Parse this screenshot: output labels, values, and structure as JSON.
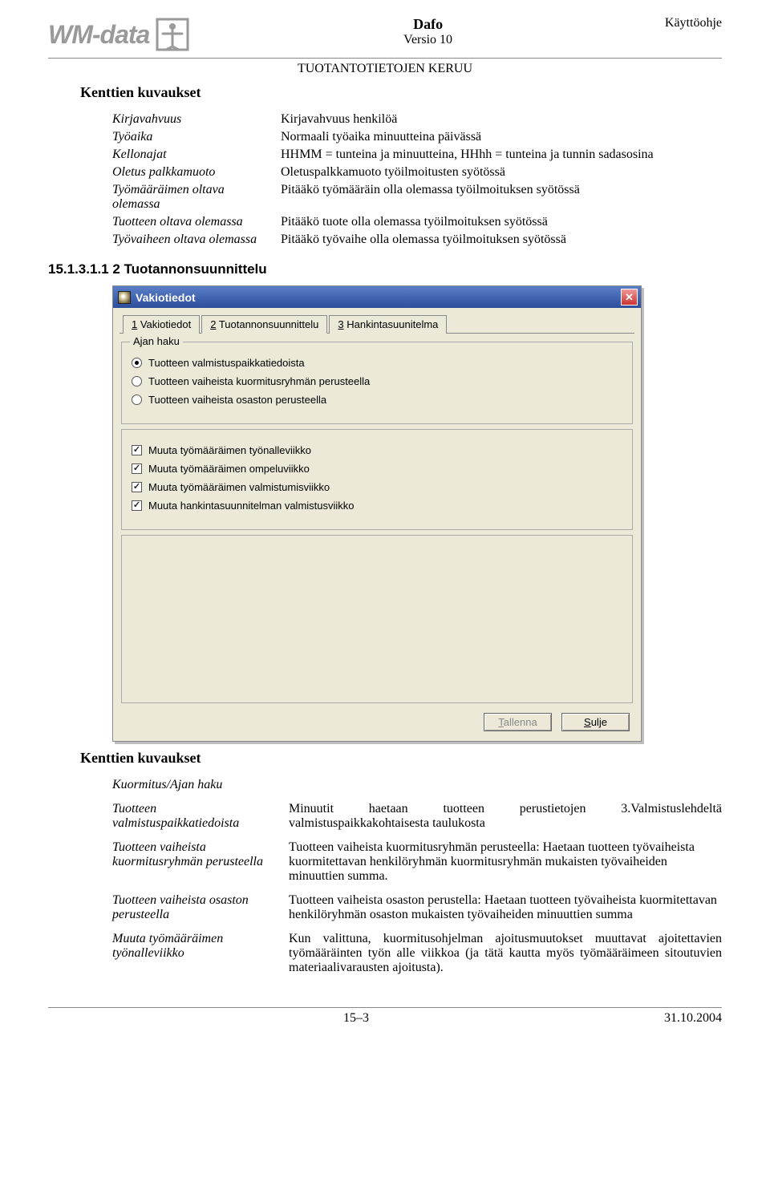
{
  "header": {
    "logo_text": "WM-data",
    "doc_title": "Dafo",
    "doc_version": "Versio 10",
    "doc_type": "Käyttöohje",
    "sub_title": "TUOTANTOTIETOJEN KERUU"
  },
  "section1_heading": "Kenttien kuvaukset",
  "defs1": [
    {
      "term": "Kirjavahvuus",
      "desc": "Kirjavahvuus henkilöä"
    },
    {
      "term": "Työaika",
      "desc": "Normaali työaika minuutteina päivässä"
    },
    {
      "term": "Kellonajat",
      "desc": "HHMM = tunteina ja minuutteina, HHhh = tunteina ja tunnin sadasosina"
    },
    {
      "term": "Oletus palkkamuoto",
      "desc": "Oletuspalkkamuoto työilmoitusten syötössä"
    },
    {
      "term": "Työmääräimen oltava olemassa",
      "desc": "Pitääkö työmääräin olla olemassa työilmoituksen syötössä"
    },
    {
      "term": "Tuotteen oltava olemassa",
      "desc": "Pitääkö tuote olla olemassa työilmoituksen syötössä"
    },
    {
      "term": "Työvaiheen oltava olemassa",
      "desc": "Pitääkö työvaihe olla olemassa työilmoituksen syötössä"
    }
  ],
  "sub_section_label": "15.1.3.1.1 2 Tuotannonsuunnittelu",
  "window": {
    "title": "Vakiotiedot",
    "tabs": [
      {
        "mnemonic": "1",
        "label": " Vakiotiedot"
      },
      {
        "mnemonic": "2",
        "label": " Tuotannonsuunnittelu",
        "active": true
      },
      {
        "mnemonic": "3",
        "label": " Hankintasuunitelma"
      }
    ],
    "group_title": "Ajan haku",
    "radios": [
      {
        "label": "Tuotteen valmistuspaikkatiedoista",
        "checked": true
      },
      {
        "label": "Tuotteen vaiheista kuormitusryhmän perusteella",
        "checked": false
      },
      {
        "label": "Tuotteen vaiheista osaston perusteella",
        "checked": false
      }
    ],
    "checks": [
      {
        "label": "Muuta työmääräimen työnalleviikko",
        "checked": true
      },
      {
        "label": "Muuta työmääräimen ompeluviikko",
        "checked": true
      },
      {
        "label": "Muuta työmääräimen valmistumisviikko",
        "checked": true
      },
      {
        "label": "Muuta hankintasuunnitelman valmistusviikko",
        "checked": true
      }
    ],
    "btn_save": "Tallenna",
    "btn_save_mn": "T",
    "btn_close": "Sulje",
    "btn_close_mn": "S"
  },
  "section2_heading": "Kenttien kuvaukset",
  "defs2_header": "Kuormitus/Ajan haku",
  "defs2": [
    {
      "term": "Tuotteen valmistuspaikkatiedoista",
      "desc": "Minuutit haetaan tuotteen perustietojen 3.Valmistuslehdeltä valmistuspaikkakohtaisesta taulukosta"
    },
    {
      "term": "Tuotteen vaiheista kuormitusryhmän perusteella",
      "desc": "Tuotteen vaiheista kuormitusryhmän perusteella: Haetaan tuotteen työvaiheista kuormitettavan henkilöryhmän kuormitusryhmän mukaisten työvaiheiden minuuttien summa."
    },
    {
      "term": "Tuotteen vaiheista osaston perusteella",
      "desc": "Tuotteen vaiheista osaston perustella: Haetaan tuotteen työvaiheista kuormitettavan henkilöryhmän osaston mukaisten työvaiheiden minuuttien summa"
    },
    {
      "term": "Muuta työmääräimen työnalleviikko",
      "desc": "Kun valittuna, kuormitusohjelman ajoitusmuutokset muuttavat ajoitettavien työmääräinten työn alle viikkoa (ja tätä kautta myös työmääräimeen sitoutuvien materiaalivarausten ajoitusta)."
    }
  ],
  "footer": {
    "left": "",
    "center": "15–3",
    "right": "31.10.2004"
  }
}
